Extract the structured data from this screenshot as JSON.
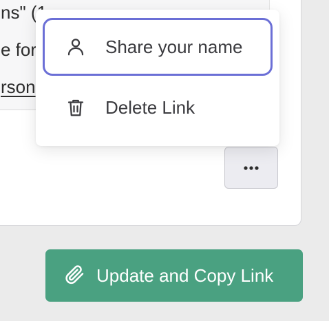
{
  "background_text": {
    "line1": "ns\" (1",
    "line2": "e for",
    "line3": "rson"
  },
  "menu": {
    "items": [
      {
        "label": "Share your name",
        "icon": "person-icon",
        "focused": true
      },
      {
        "label": "Delete Link",
        "icon": "trash-icon",
        "focused": false
      }
    ]
  },
  "more_button": {
    "icon": "more-horizontal-icon",
    "glyph": "•••"
  },
  "primary_button": {
    "label": "Update and Copy Link",
    "icon": "paperclip-icon"
  },
  "colors": {
    "accent": "#4aa181",
    "focus_ring": "#6b6fd6",
    "menu_text": "#3b3b3f"
  }
}
